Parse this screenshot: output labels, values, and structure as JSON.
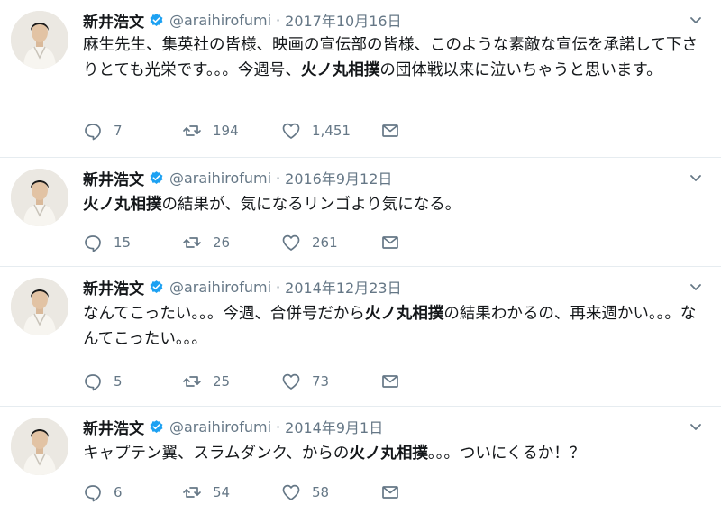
{
  "account": {
    "name": "新井浩文",
    "handle": "@araihirofumi",
    "separator": "·"
  },
  "icons": {
    "verified": "verified-badge-icon",
    "caret": "chevron-down-icon",
    "reply": "reply-icon",
    "retweet": "retweet-icon",
    "like": "heart-icon",
    "dm": "envelope-icon",
    "avatar": "avatar-photo"
  },
  "colors": {
    "verified_blue": "#1da1f2",
    "secondary_text": "#657786",
    "divider": "#e6ecf0"
  },
  "tweets": [
    {
      "date": "2017年10月16日",
      "text_parts": [
        "麻生先生、集英社の皆様、映画の宣伝部の皆様、このような素敵な宣伝を承諾して下さりとても光栄です。。。今週号、",
        "火ノ丸相撲",
        "の団体戦以来に泣いちゃうと思います。"
      ],
      "replies": "7",
      "retweets": "194",
      "likes": "1,451"
    },
    {
      "date": "2016年9月12日",
      "text_parts": [
        "",
        "火ノ丸相撲",
        "の結果が、気になるリンゴより気になる。"
      ],
      "replies": "15",
      "retweets": "26",
      "likes": "261"
    },
    {
      "date": "2014年12月23日",
      "text_parts": [
        "なんてこったい。。。今週、合併号だから",
        "火ノ丸相撲",
        "の結果わかるの、再来週かい。。。なんてこったい。。。"
      ],
      "replies": "5",
      "retweets": "25",
      "likes": "73"
    },
    {
      "date": "2014年9月1日",
      "text_parts": [
        "キャプテン翼、スラムダンク、からの",
        "火ノ丸相撲",
        "。。。ついにくるか！？"
      ],
      "replies": "6",
      "retweets": "54",
      "likes": "58"
    }
  ]
}
